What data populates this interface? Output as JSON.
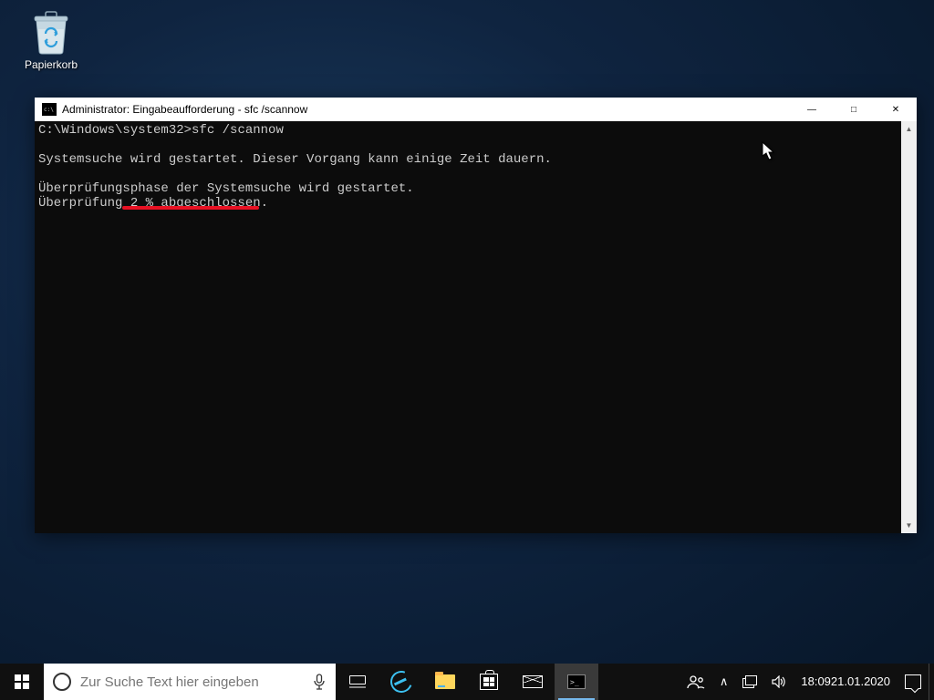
{
  "desktop": {
    "recycle_bin_label": "Papierkorb"
  },
  "cmd": {
    "title": "Administrator: Eingabeaufforderung - sfc  /scannow",
    "prompt": "C:\\Windows\\system32>",
    "command": "sfc /scannow",
    "line_start": "Systemsuche wird gestartet. Dieser Vorgang kann einige Zeit dauern.",
    "line_phase": "Überprüfungsphase der Systemsuche wird gestartet.",
    "line_progress": "Überprüfung 2 % abgeschlossen."
  },
  "taskbar": {
    "search_placeholder": "Zur Suche Text hier eingeben"
  },
  "tray": {
    "time": "18:09",
    "date": "21.01.2020"
  }
}
